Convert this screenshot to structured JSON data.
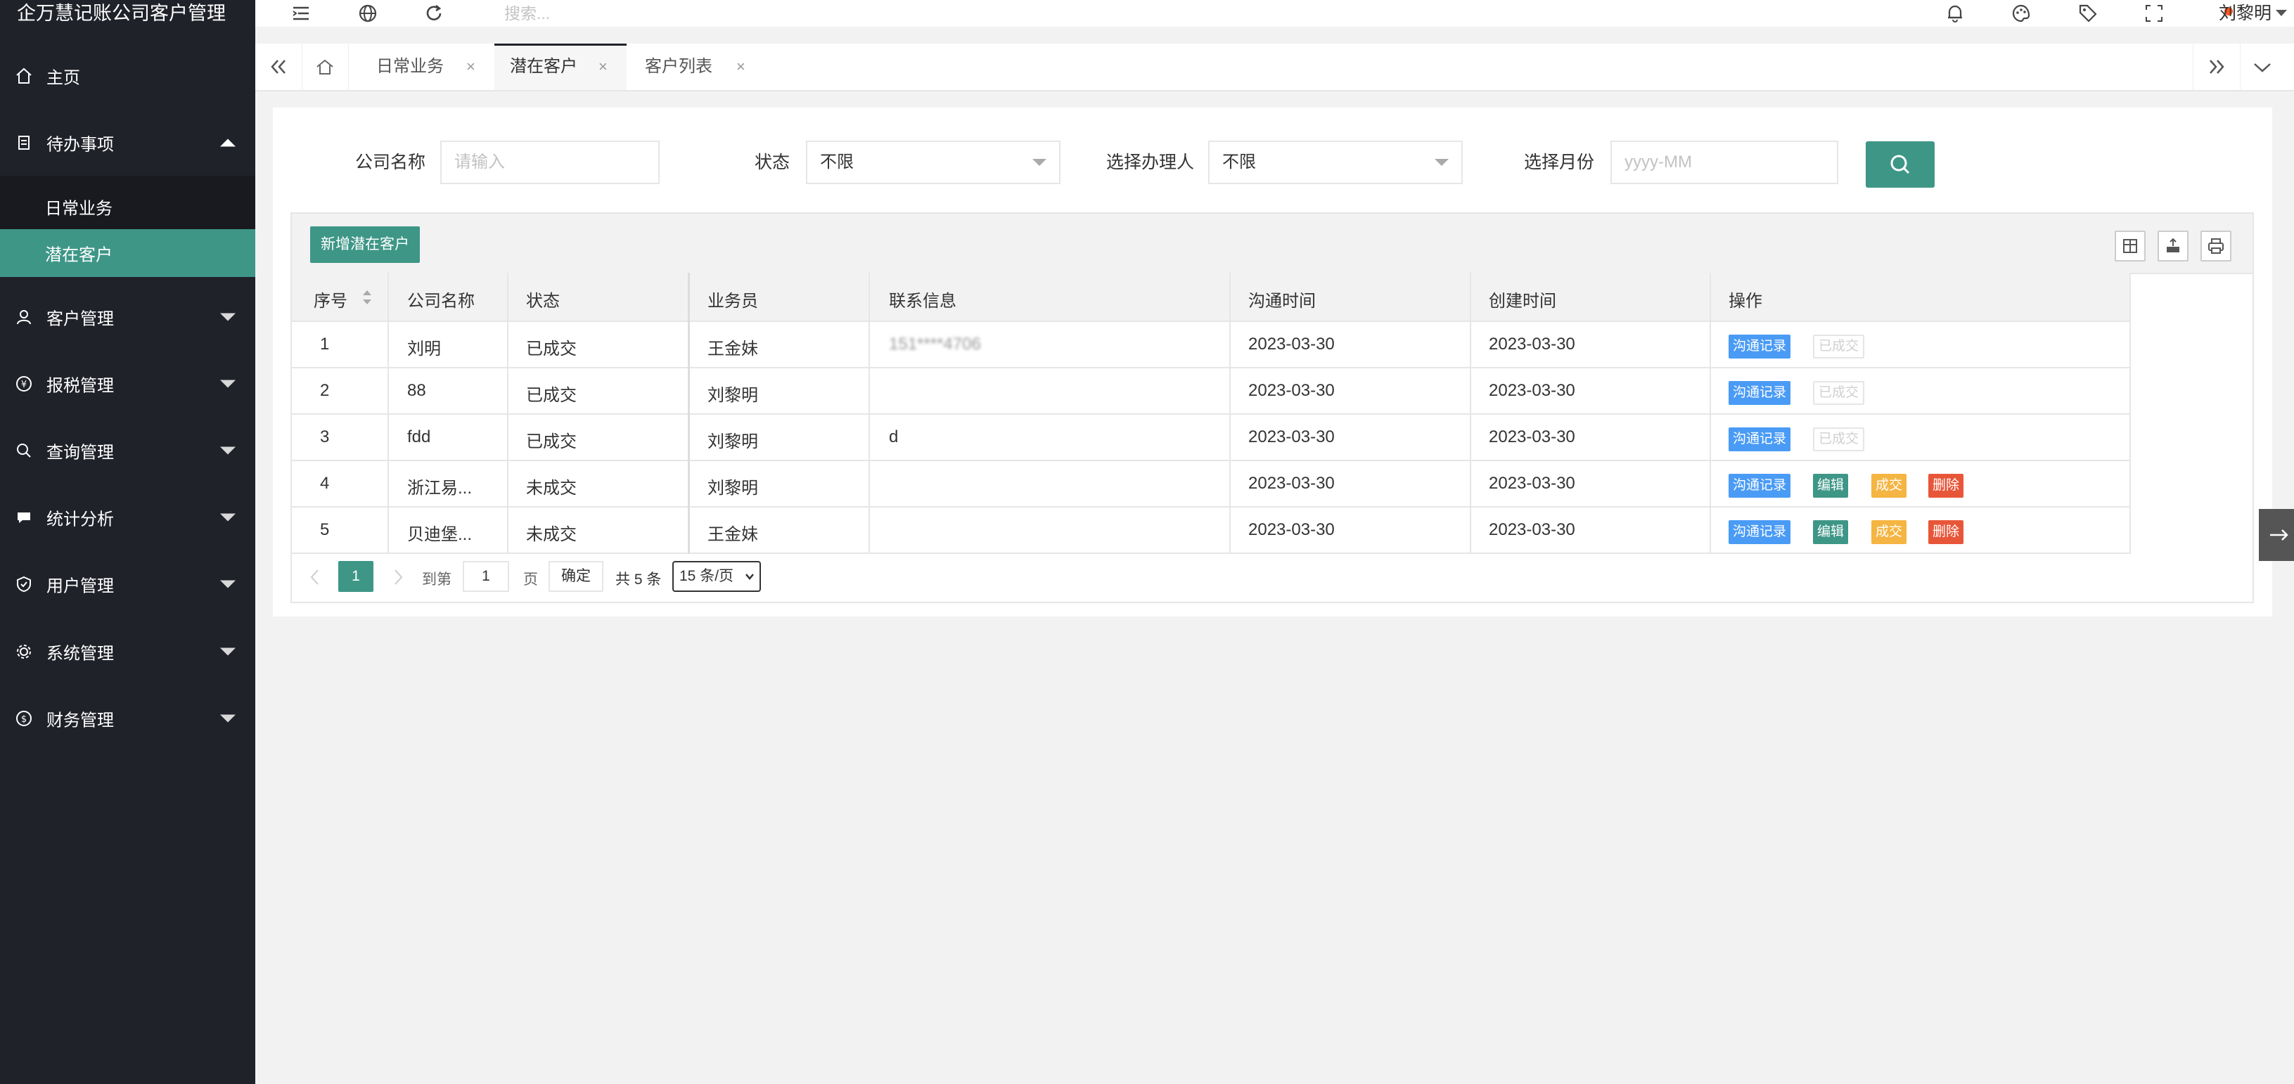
{
  "app": {
    "title": "企万慧记账公司客户管理"
  },
  "sidebar": {
    "home": "主页",
    "todo": {
      "label": "待办事项",
      "children": [
        "日常业务",
        "潜在客户"
      ]
    },
    "groups": [
      "客户管理",
      "报税管理",
      "查询管理",
      "统计分析",
      "用户管理",
      "系统管理",
      "财务管理"
    ]
  },
  "header": {
    "search_placeholder": "搜索...",
    "user": "刘黎明"
  },
  "tabs": [
    "日常业务",
    "潜在客户",
    "客户列表"
  ],
  "filters": {
    "company_label": "公司名称",
    "company_placeholder": "请输入",
    "status_label": "状态",
    "status_value": "不限",
    "handler_label": "选择办理人",
    "handler_value": "不限",
    "month_label": "选择月份",
    "month_placeholder": "yyyy-MM"
  },
  "toolbar": {
    "add_label": "新增潜在客户"
  },
  "table": {
    "headers": [
      "序号",
      "公司名称",
      "状态",
      "业务员",
      "联系信息",
      "沟通时间",
      "创建时间",
      "操作"
    ],
    "rows": [
      {
        "no": "1",
        "company": "刘明",
        "status": "已成交",
        "staff": "王金妹",
        "contact": "151****4706",
        "comm_time": "2023-03-30",
        "created": "2023-03-30"
      },
      {
        "no": "2",
        "company": "88",
        "status": "已成交",
        "staff": "刘黎明",
        "contact": "",
        "comm_time": "2023-03-30",
        "created": "2023-03-30"
      },
      {
        "no": "3",
        "company": "fdd",
        "status": "已成交",
        "staff": "刘黎明",
        "contact": "d",
        "comm_time": "2023-03-30",
        "created": "2023-03-30"
      },
      {
        "no": "4",
        "company": "浙江易...",
        "status": "未成交",
        "staff": "刘黎明",
        "contact": "",
        "comm_time": "2023-03-30",
        "created": "2023-03-30"
      },
      {
        "no": "5",
        "company": "贝迪堡...",
        "status": "未成交",
        "staff": "王金妹",
        "contact": "",
        "comm_time": "2023-03-30",
        "created": "2023-03-30"
      }
    ],
    "actions": {
      "record": "沟通记录",
      "done": "已成交",
      "edit": "编辑",
      "deal": "成交",
      "delete": "删除"
    }
  },
  "pagination": {
    "current": "1",
    "goto": "到第",
    "page_unit": "页",
    "input": "1",
    "confirm": "确定",
    "total": "共 5 条",
    "page_size": "15 条/页"
  },
  "colors": {
    "sidebar": "#20222a",
    "accent": "#3e9687",
    "blue": "#4a9bf5",
    "orange": "#f5b542",
    "red": "#e8563a"
  }
}
